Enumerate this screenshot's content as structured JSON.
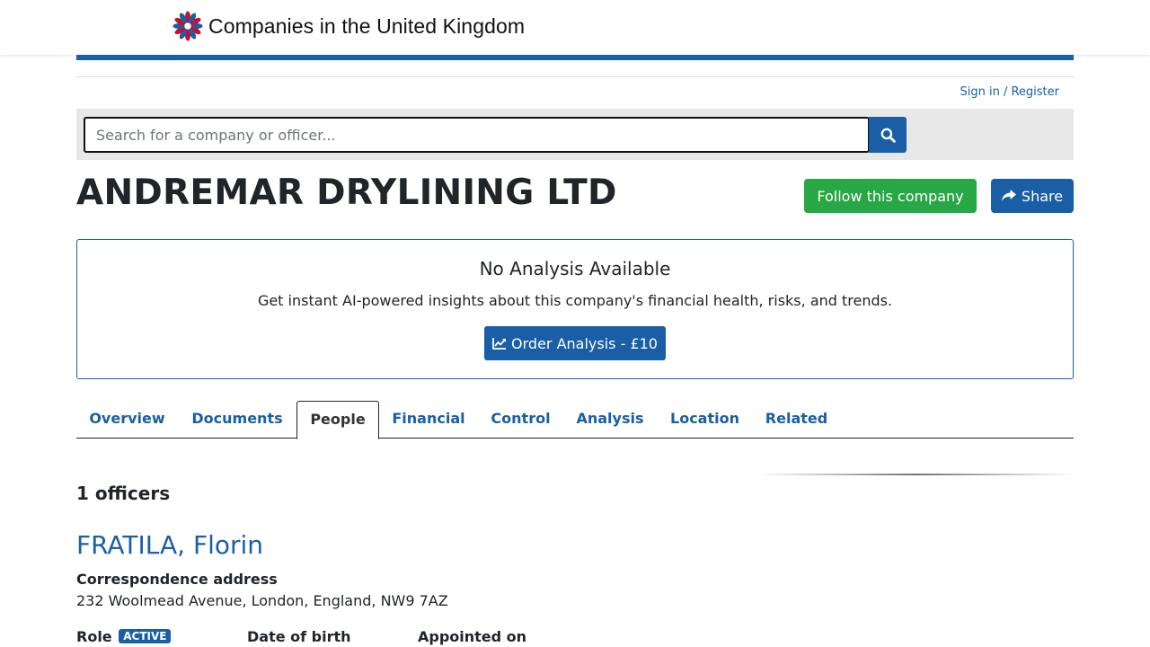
{
  "header": {
    "title": "Companies in the United Kingdom",
    "logo_icon": "flower-logo-icon",
    "signin_label": "Sign in / Register"
  },
  "search": {
    "placeholder": "Search for a company or officer...",
    "value": "",
    "button_icon": "search-icon"
  },
  "company": {
    "name": "ANDREMAR DRYLINING LTD",
    "follow_label": "Follow this company",
    "share_label": "Share",
    "share_icon": "share-icon"
  },
  "analysis": {
    "title": "No Analysis Available",
    "description": "Get instant AI-powered insights about this company's financial health, risks, and trends.",
    "order_label": "Order Analysis - £10",
    "order_icon": "line-chart-icon"
  },
  "tabs": [
    {
      "label": "Overview",
      "active": false
    },
    {
      "label": "Documents",
      "active": false
    },
    {
      "label": "People",
      "active": true
    },
    {
      "label": "Financial",
      "active": false
    },
    {
      "label": "Control",
      "active": false
    },
    {
      "label": "Analysis",
      "active": false
    },
    {
      "label": "Location",
      "active": false
    },
    {
      "label": "Related",
      "active": false
    }
  ],
  "officers": {
    "count_label": "1 officers",
    "items": [
      {
        "name": "FRATILA, Florin",
        "address_label": "Correspondence address",
        "address": "232 Woolmead Avenue, London, England, NW9 7AZ",
        "role_label": "Role",
        "role_status": "ACTIVE",
        "dob_label": "Date of birth",
        "appointed_label": "Appointed on"
      }
    ]
  },
  "colors": {
    "brand_blue": "#1a5fa6",
    "follow_green": "#28a745",
    "search_band": "#e8e8e8"
  }
}
